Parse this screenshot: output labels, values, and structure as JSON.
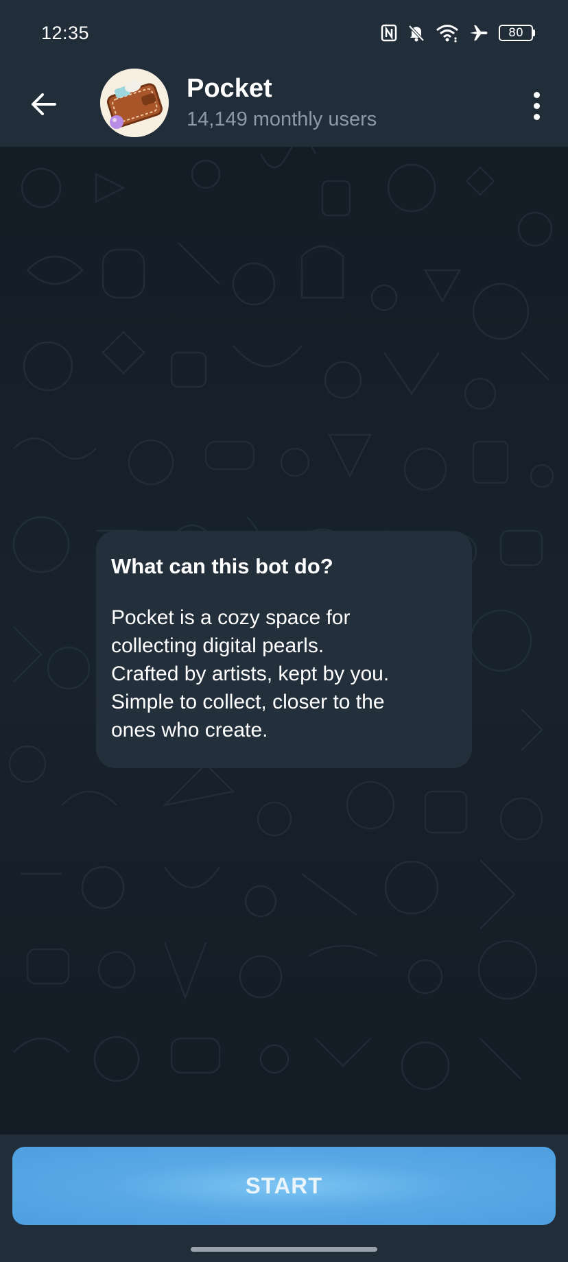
{
  "status_bar": {
    "time": "12:35",
    "icons": [
      "nfc-icon",
      "mute-icon",
      "wifi-icon",
      "airplane-icon"
    ],
    "battery": "80"
  },
  "header": {
    "title": "Pocket",
    "subtitle": "14,149 monthly users",
    "back_icon": "arrow-left-icon",
    "menu_icon": "more-vertical-icon"
  },
  "bot_info": {
    "title": "What can this bot do?",
    "description": "Pocket is a cozy space for\ncollecting digital pearls.\nCrafted by artists, kept by you.\nSimple to collect, closer to the\nones who create."
  },
  "footer": {
    "start_label": "START"
  },
  "colors": {
    "header_bg": "#222d3a",
    "chat_bg": "#17212b",
    "card_bg": "#232f3b",
    "accent": "#5aa9e6",
    "subtitle": "#8d99a6"
  }
}
